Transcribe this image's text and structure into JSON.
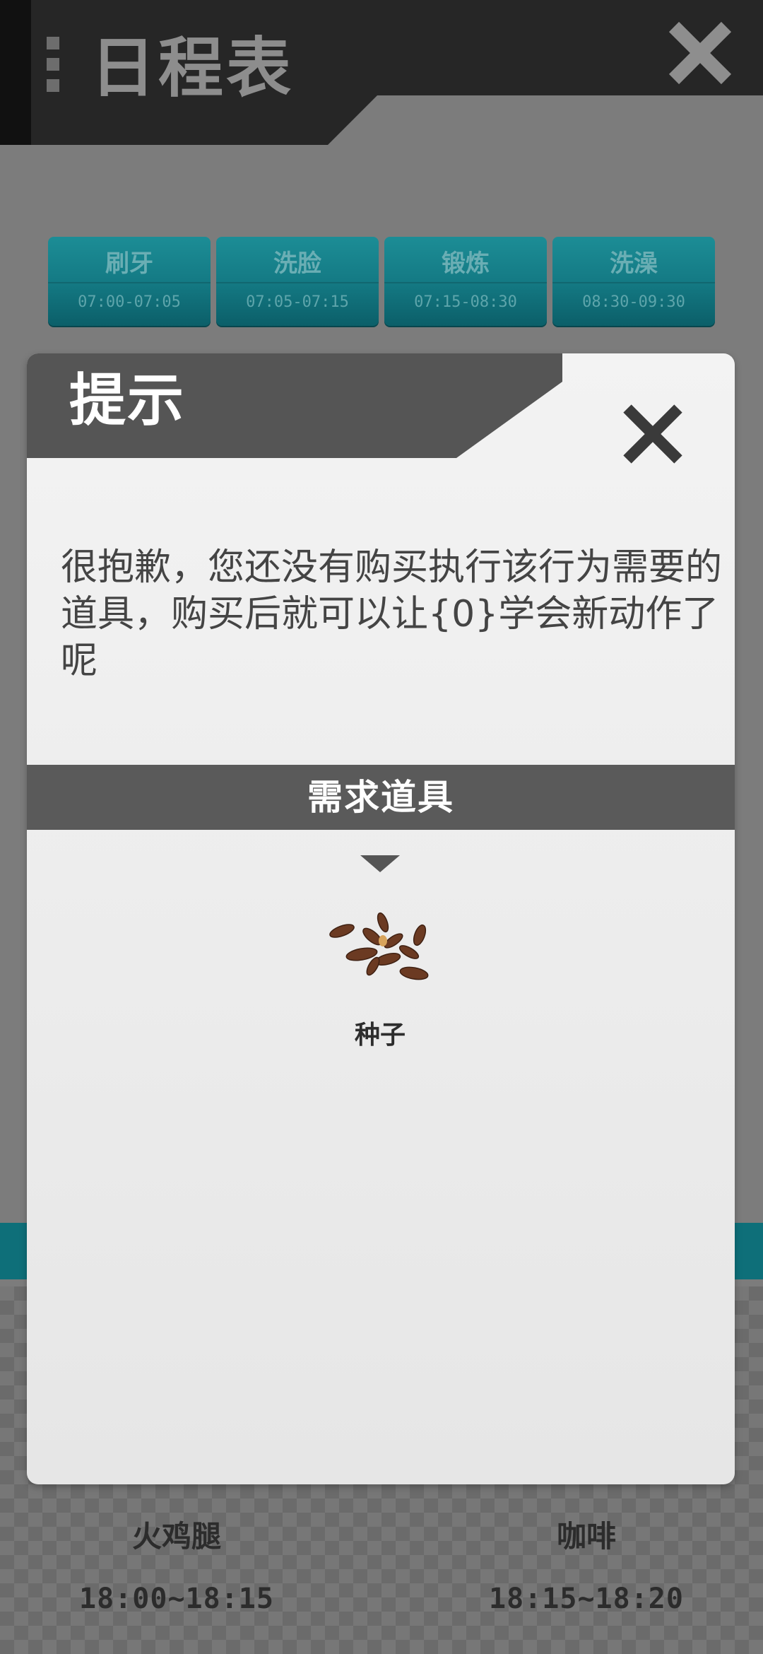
{
  "header": {
    "title": "日程表"
  },
  "tasks": [
    {
      "name": "刷牙",
      "time": "07:00-07:05"
    },
    {
      "name": "洗脸",
      "time": "07:05-07:15"
    },
    {
      "name": "锻炼",
      "time": "07:15-08:30"
    },
    {
      "name": "洗澡",
      "time": "08:30-09:30"
    }
  ],
  "footer": [
    {
      "name": "火鸡腿",
      "time": "18:00~18:15"
    },
    {
      "name": "咖啡",
      "time": "18:15~18:20"
    }
  ],
  "modal": {
    "title": "提示",
    "message": "很抱歉，您还没有购买执行该行为需要的道具，购买后就可以让{0}学会新动作了呢",
    "section_title": "需求道具",
    "item": {
      "name": "种子",
      "icon": "seeds-icon"
    }
  },
  "colors": {
    "teal": "#147a84",
    "modal_header": "#555555",
    "background": "#7c7c7c"
  }
}
